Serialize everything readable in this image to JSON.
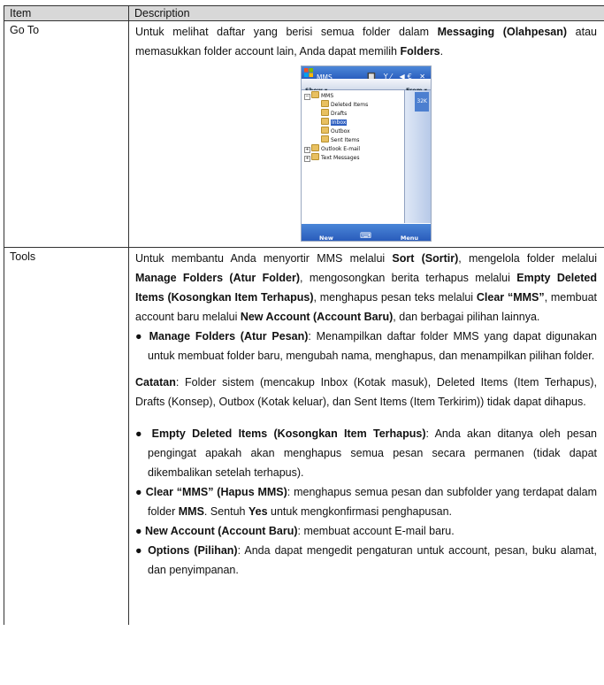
{
  "table": {
    "headers": {
      "item": "Item",
      "description": "Description"
    },
    "goto": {
      "item": "Go To",
      "text": [
        {
          "t": "Untuk melihat daftar yang berisi semua folder dalam ",
          "b": false
        },
        {
          "t": "Messaging (Olahpesan)",
          "b": true
        },
        {
          "t": " atau memasukkan folder account lain, Anda dapat memilih ",
          "b": false
        },
        {
          "t": "Folders",
          "b": true
        },
        {
          "t": ".",
          "b": false
        }
      ]
    },
    "tools": {
      "item": "Tools",
      "intro": [
        {
          "t": "Untuk membantu Anda menyortir MMS melalui ",
          "b": false
        },
        {
          "t": "Sort (Sortir)",
          "b": true
        },
        {
          "t": ", mengelola folder melalui ",
          "b": false
        },
        {
          "t": "Manage Folders (Atur Folder)",
          "b": true
        },
        {
          "t": ", mengosongkan berita terhapus melalui ",
          "b": false
        },
        {
          "t": "Empty Deleted Items (Kosongkan Item Terhapus)",
          "b": true
        },
        {
          "t": ", menghapus pesan teks melalui ",
          "b": false
        },
        {
          "t": "Clear “MMS”",
          "b": true
        },
        {
          "t": ", membuat account baru melalui ",
          "b": false
        },
        {
          "t": "New Account (Account Baru)",
          "b": true
        },
        {
          "t": ", dan berbagai pilihan lainnya.",
          "b": false
        }
      ],
      "bullet1": [
        {
          "t": "● ",
          "b": false
        },
        {
          "t": "Manage Folders (Atur Pesan)",
          "b": true
        },
        {
          "t": ": Menampilkan daftar folder MMS yang dapat digunakan untuk membuat folder baru, mengubah nama, menghapus, dan menampilkan pilihan folder.",
          "b": false
        }
      ],
      "note": [
        {
          "t": "Catatan",
          "b": true
        },
        {
          "t": ": Folder sistem (mencakup Inbox (Kotak masuk), Deleted Items (Item Terhapus), Drafts (Konsep), Outbox (Kotak keluar), dan Sent Items (Item Terkirim)) tidak dapat dihapus.",
          "b": false
        }
      ],
      "bullet2": [
        {
          "t": "● ",
          "b": false
        },
        {
          "t": "Empty Deleted Items (Kosongkan Item Terhapus)",
          "b": true
        },
        {
          "t": ": Anda akan ditanya oleh pesan pengingat apakah akan menghapus semua pesan secara permanen (tidak dapat dikembalikan setelah terhapus).",
          "b": false
        }
      ],
      "bullet3": [
        {
          "t": "● ",
          "b": false
        },
        {
          "t": "Clear “MMS” (Hapus MMS)",
          "b": true
        },
        {
          "t": ": menghapus semua pesan dan subfolder yang terdapat dalam folder ",
          "b": false
        },
        {
          "t": "MMS",
          "b": true
        },
        {
          "t": ". Sentuh ",
          "b": false
        },
        {
          "t": "Yes",
          "b": true
        },
        {
          "t": " untuk mengkonfirmasi penghapusan.",
          "b": false
        }
      ],
      "bullet4": [
        {
          "t": "● ",
          "b": false
        },
        {
          "t": "New Account (Account Baru)",
          "b": true
        },
        {
          "t": ": membuat account E-mail baru.",
          "b": false
        }
      ],
      "bullet5": [
        {
          "t": "● ",
          "b": false
        },
        {
          "t": "Options (Pilihan)",
          "b": true
        },
        {
          "t": ": Anda dapat mengedit pengaturan untuk account, pesan, buku alamat, dan penyimpanan.",
          "b": false
        }
      ]
    }
  },
  "phone": {
    "title": "MMS",
    "tray": "🔲 Y⁄ ◀€ ✕",
    "show": "Show ▾",
    "from": "From ▾",
    "size": "32K",
    "tree": {
      "root": "MMS",
      "deleted": "Deleted Items",
      "drafts": "Drafts",
      "inbox": "Inbox",
      "outbox": "Outbox",
      "sent": "Sent Items",
      "outlook": "Outlook E-mail",
      "text": "Text Messages"
    },
    "menu_new": "New",
    "menu_kbd": "⌨",
    "menu_menu": "Menu"
  }
}
